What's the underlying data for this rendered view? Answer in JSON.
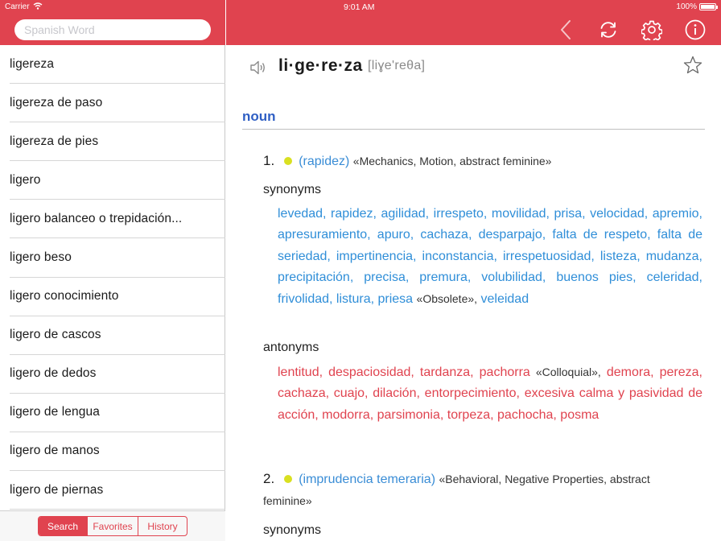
{
  "status": {
    "carrier": "Carrier",
    "time": "9:01 AM",
    "battery": "100%"
  },
  "search": {
    "placeholder": "Spanish Word"
  },
  "word_list": [
    "ligereza",
    "ligereza de paso",
    "ligereza de pies",
    "ligero",
    "ligero balanceo o trepidación...",
    "ligero beso",
    "ligero conocimiento",
    "ligero de cascos",
    "ligero de dedos",
    "ligero de lengua",
    "ligero de manos",
    "ligero de piernas"
  ],
  "tabs": {
    "search": "Search",
    "favorites": "Favorites",
    "history": "History",
    "active": "Search"
  },
  "entry": {
    "headword": "li·ge·re·za",
    "pronunciation": "[liɣe'reθa]",
    "part_of_speech": "noun",
    "senses": [
      {
        "number": "1.",
        "gloss": "(rapidez)",
        "labels": "«Mechanics, Motion, abstract feminine»",
        "synonyms_label": "synonyms",
        "synonyms_text": "levedad, rapidez, agilidad, irrespeto, movilidad, prisa, velocidad, apremio, apresuramiento, apuro, cachaza, desparpajo, falta de respeto, falta de seriedad, impertinencia, inconstancia, irrespetuosidad, listeza, mudanza, precipitación, precisa, premura, volubilidad, buenos pies, celeridad, frivolidad, listura, priesa",
        "synonyms_tag": "«Obsolete»,",
        "synonyms_tail": "veleidad",
        "antonyms_label": "antonyms",
        "antonyms_text": "lentitud, despaciosidad, tardanza, pachorra",
        "antonyms_tag": "«Colloquial»,",
        "antonyms_tail": "demora, pereza, cachaza, cuajo, dilación, entorpecimiento, excesiva calma y pasividad de acción, modorra, parsimonia, torpeza, pachocha, posma"
      },
      {
        "number": "2.",
        "gloss": "(imprudencia temeraria)",
        "labels": "«Behavioral, Negative Properties, abstract",
        "labels_cont": "feminine»",
        "synonyms_label": "synonyms"
      }
    ]
  },
  "colors": {
    "accent": "#e0434f",
    "synonym": "#2f8ed8",
    "pos": "#2f5fc4",
    "sense_dot": "#d9e021"
  },
  "icons": [
    "wifi-icon",
    "back-icon",
    "refresh-icon",
    "settings-icon",
    "info-icon",
    "speaker-icon",
    "star-icon"
  ]
}
